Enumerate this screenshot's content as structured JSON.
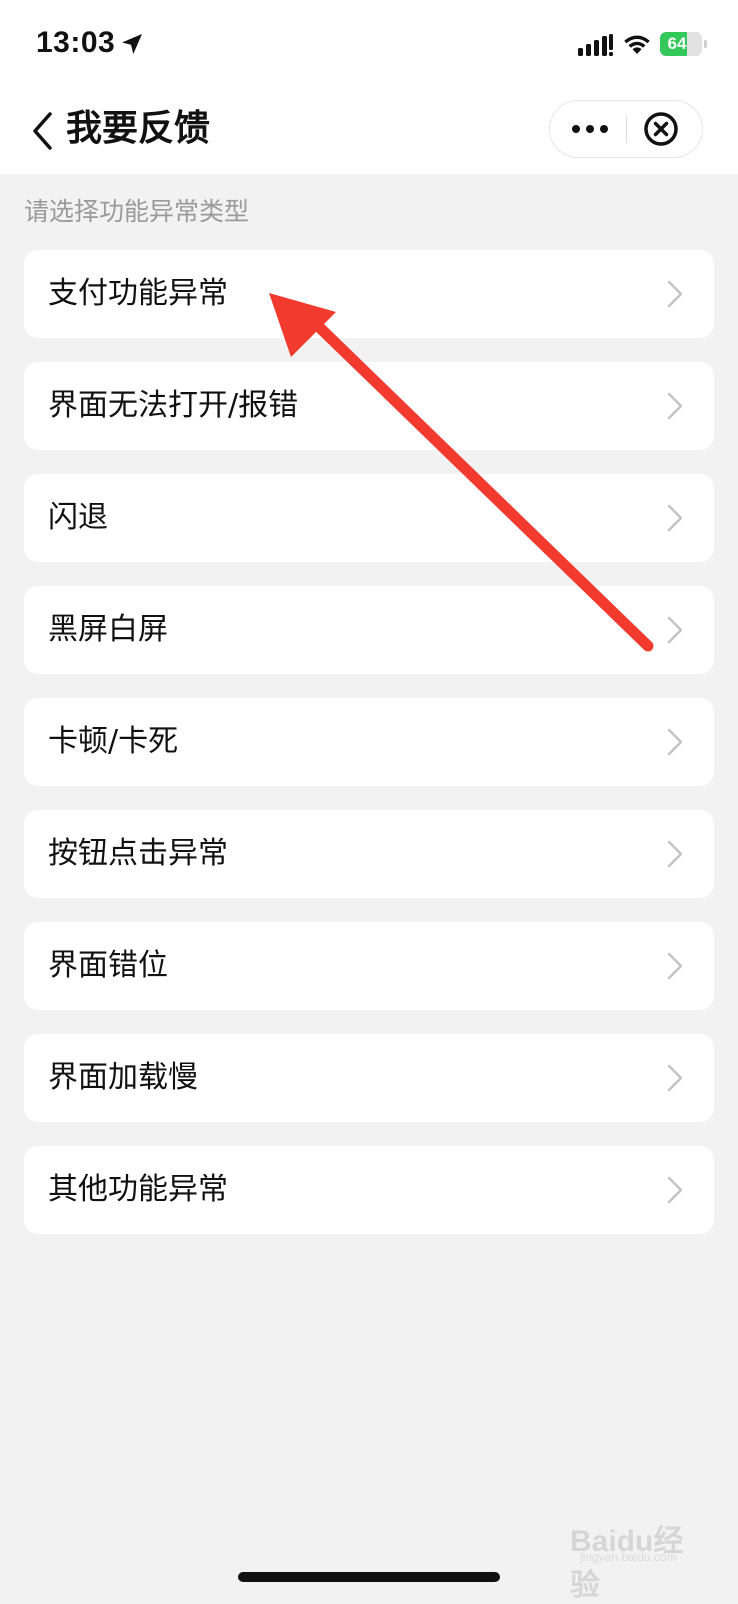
{
  "status_bar": {
    "time": "13:03",
    "battery_level": "64",
    "battery_color": "#34c759"
  },
  "nav": {
    "title": "我要反馈",
    "back_icon": "chevron-left-icon",
    "more_icon": "more-horizontal-icon",
    "close_icon": "close-circle-icon"
  },
  "section_label": "请选择功能异常类型",
  "items": [
    {
      "label": "支付功能异常"
    },
    {
      "label": "界面无法打开/报错"
    },
    {
      "label": "闪退"
    },
    {
      "label": "黑屏白屏"
    },
    {
      "label": "卡顿/卡死"
    },
    {
      "label": "按钮点击异常"
    },
    {
      "label": "界面错位"
    },
    {
      "label": "界面加载慢"
    },
    {
      "label": "其他功能异常"
    }
  ],
  "annotation": {
    "color": "#f23a2e"
  },
  "watermark": {
    "brand": "Baidu经验",
    "domain": "jingyan.baidu.com"
  }
}
